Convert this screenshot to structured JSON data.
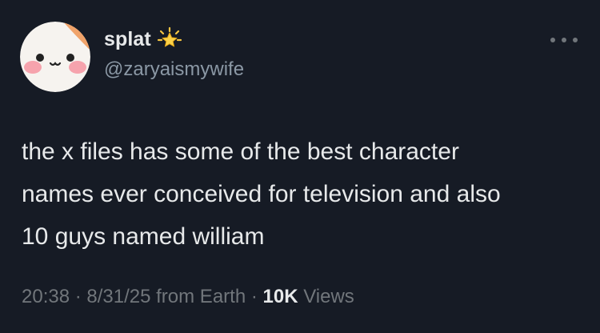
{
  "user": {
    "display_name": "splat",
    "handle": "@zaryaismywife",
    "badge_icon": "sparkle-star-icon",
    "avatar_icon": "cute-face-avatar"
  },
  "tweet": {
    "lines": [
      "the x files has some of the best character",
      "names ever conceived for television and also",
      "10 guys named william"
    ]
  },
  "meta": {
    "time": "20:38",
    "separator": " · ",
    "date": "8/31/25",
    "source": "from Earth",
    "views_count": "10K",
    "views_label": "Views"
  },
  "colors": {
    "background": "#161b25",
    "text": "#e7e9ea",
    "secondary": "#8b98a5",
    "muted": "#71767b"
  }
}
